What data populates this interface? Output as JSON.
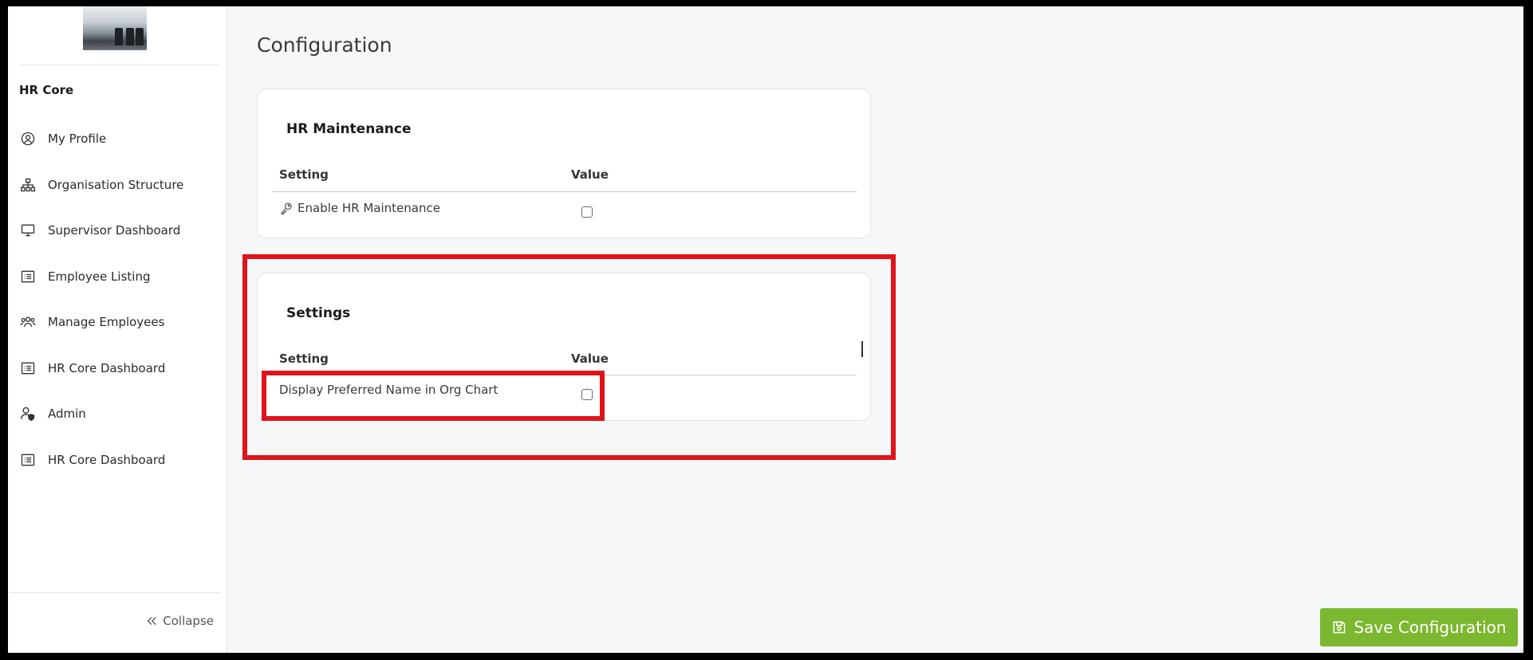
{
  "sidebar": {
    "section_title": "HR Core",
    "items": [
      {
        "label": "My Profile",
        "icon": "user-circle-icon"
      },
      {
        "label": "Organisation Structure",
        "icon": "org-chart-icon"
      },
      {
        "label": "Supervisor Dashboard",
        "icon": "monitor-icon"
      },
      {
        "label": "Employee Listing",
        "icon": "list-icon"
      },
      {
        "label": "Manage Employees",
        "icon": "users-icon"
      },
      {
        "label": "HR Core Dashboard",
        "icon": "list-icon"
      },
      {
        "label": "Admin",
        "icon": "admin-user-icon"
      },
      {
        "label": "HR Core Dashboard",
        "icon": "list-icon"
      }
    ],
    "collapse_label": "Collapse"
  },
  "main": {
    "page_title": "Configuration",
    "cards": [
      {
        "title": "HR Maintenance",
        "col_setting": "Setting",
        "col_value": "Value",
        "rows": [
          {
            "label": "Enable HR Maintenance",
            "icon": "key-icon",
            "checked": false
          }
        ]
      },
      {
        "title": "Settings",
        "col_setting": "Setting",
        "col_value": "Value",
        "rows": [
          {
            "label": "Display Preferred Name in Org Chart",
            "checked": false
          }
        ]
      }
    ]
  },
  "actions": {
    "save_label": "Save Configuration"
  },
  "colors": {
    "highlight": "#e0141b",
    "save_button": "#7cb82f",
    "background": "#f6f7f9"
  }
}
